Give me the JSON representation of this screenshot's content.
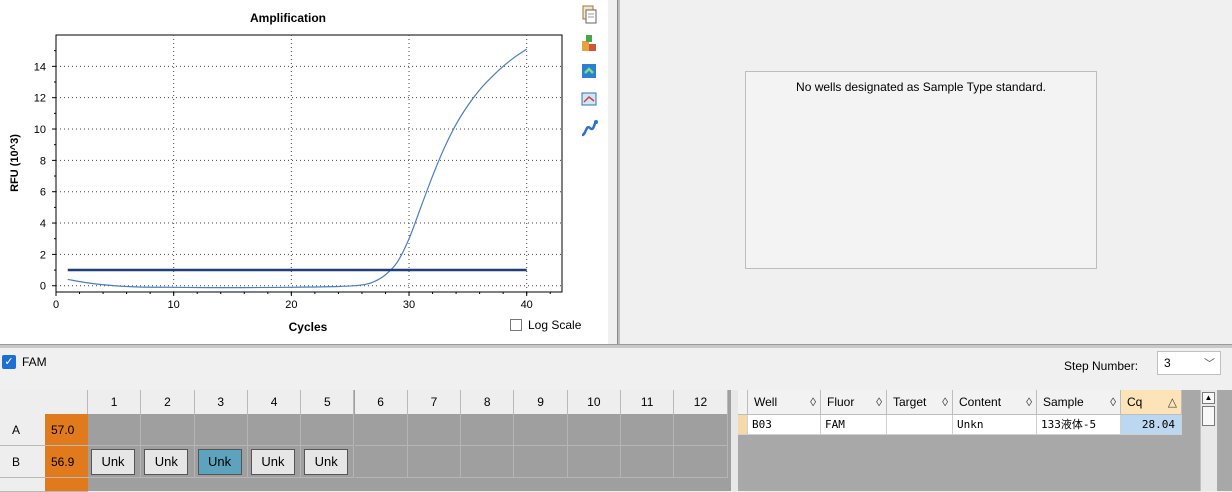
{
  "chart_data": {
    "type": "line",
    "title": "Amplification",
    "xlabel": "Cycles",
    "ylabel": "RFU (10^3)",
    "xlim": [
      0,
      43
    ],
    "ylim": [
      -0.4,
      16
    ],
    "x_ticks": [
      0,
      10,
      20,
      30,
      40
    ],
    "y_ticks": [
      0,
      2,
      4,
      6,
      8,
      10,
      12,
      14
    ],
    "grid": true,
    "series": [
      {
        "color": "#4a7fbf",
        "x": [
          1,
          3,
          5,
          7,
          10,
          13,
          16,
          20,
          24,
          26,
          27,
          28,
          29,
          30,
          31,
          32,
          33,
          34,
          35,
          36,
          37,
          38,
          39,
          40
        ],
        "y": [
          0.4,
          0.15,
          0.0,
          -0.08,
          -0.1,
          -0.12,
          -0.12,
          -0.1,
          -0.05,
          0.05,
          0.25,
          0.7,
          1.5,
          3.0,
          5.0,
          7.0,
          8.8,
          10.3,
          11.5,
          12.5,
          13.3,
          14.0,
          14.6,
          15.1
        ]
      },
      {
        "color": "#1f3f7a",
        "x": [
          1,
          40
        ],
        "y": [
          1.0,
          1.0
        ]
      }
    ]
  },
  "chart": {
    "log_scale_label": "Log Scale",
    "log_scale_checked": false
  },
  "toolbar_icons": [
    "copy-icon",
    "export-icon",
    "refresh-icon",
    "zoom-icon",
    "curve-icon"
  ],
  "std_curve": {
    "message": "No wells designated as Sample Type standard."
  },
  "fluor_filter": {
    "label": "FAM",
    "checked": true
  },
  "step": {
    "label": "Step Number:",
    "value": "3"
  },
  "plate": {
    "columns": [
      "1",
      "2",
      "3",
      "4",
      "5",
      "6",
      "7",
      "8",
      "9",
      "10",
      "11",
      "12"
    ],
    "rows": [
      {
        "label": "A",
        "temp": "57.0",
        "wells": [
          "",
          "",
          "",
          "",
          "",
          "",
          "",
          "",
          "",
          "",
          "",
          ""
        ]
      },
      {
        "label": "B",
        "temp": "56.9",
        "wells": [
          "Unk",
          "Unk",
          "Unk",
          "Unk",
          "Unk",
          "",
          "",
          "",
          "",
          "",
          "",
          ""
        ]
      }
    ],
    "selected": "B3",
    "colors": {
      "temp_bg": "#e07a1c",
      "selected_well": "#5ea3be"
    }
  },
  "results": {
    "headers": [
      "Well",
      "Fluor",
      "Target",
      "Content",
      "Sample",
      "Cq"
    ],
    "rows": [
      {
        "well": "B03",
        "fluor": "FAM",
        "target": "",
        "content": "Unkn",
        "sample": "133液体-5",
        "cq": "28.04"
      }
    ]
  }
}
